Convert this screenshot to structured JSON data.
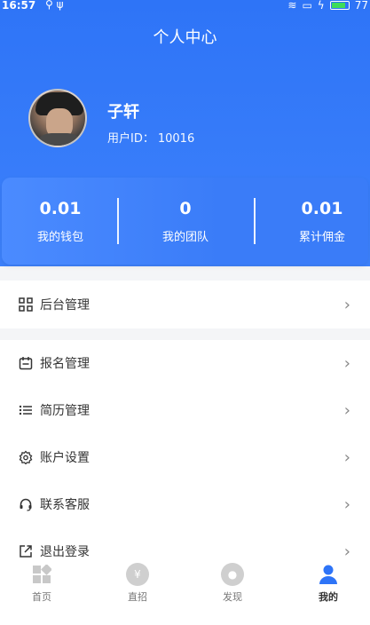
{
  "status_bar": {
    "time": "16:57",
    "battery": "77"
  },
  "header": {
    "title": "个人中心"
  },
  "profile": {
    "name": "子轩",
    "id_label": "用户ID：",
    "id_value": "10016"
  },
  "stats": [
    {
      "value": "0.01",
      "label": "我的钱包"
    },
    {
      "value": "0",
      "label": "我的团队"
    },
    {
      "value": "0.01",
      "label": "累计佣金"
    }
  ],
  "menu": {
    "admin": {
      "label": "后台管理"
    },
    "items": [
      {
        "label": "报名管理"
      },
      {
        "label": "简历管理"
      },
      {
        "label": "账户设置"
      },
      {
        "label": "联系客服"
      },
      {
        "label": "退出登录"
      }
    ]
  },
  "tabs": [
    {
      "label": "首页"
    },
    {
      "label": "直招"
    },
    {
      "label": "发现"
    },
    {
      "label": "我的"
    }
  ],
  "colors": {
    "primary": "#2e74f7",
    "stats_bg": "#4b8bff",
    "battery": "#3ddc5a"
  }
}
